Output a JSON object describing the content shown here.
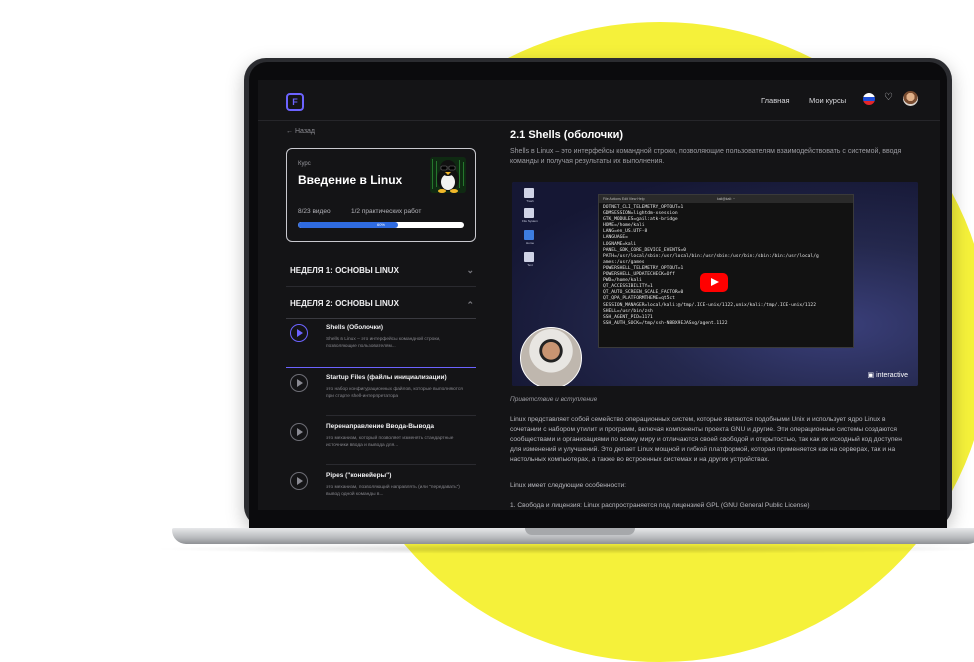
{
  "header": {
    "nav_home": "Главная",
    "nav_my_courses": "Мои курсы",
    "logo_icon": "logo-icon",
    "bell_icon": "bell-icon"
  },
  "sidebar": {
    "back_label": "← Назад",
    "course": {
      "kicker": "Курс",
      "title": "Введение в Linux",
      "videos": "8/23 видео",
      "practicals": "1/2 практических работ",
      "progress_label": "60%",
      "progress": 0.6
    },
    "weeks": [
      {
        "label": "НЕДЕЛЯ 1: ОСНОВЫ LINUX",
        "expanded": false
      },
      {
        "label": "НЕДЕЛЯ 2: ОСНОВЫ LINUX",
        "expanded": true
      }
    ],
    "lessons": [
      {
        "title": "Shells (Оболочки)",
        "desc": "Shells в Linux – это интерфейсы командной строки, позволяющие пользователям..."
      },
      {
        "title": "Startup Files (файлы инициализации)",
        "desc": "это набор конфигурационных файлов, которые выполняются при старте shell-интерпретатора"
      },
      {
        "title": "Перенаправление Ввода-Вывода",
        "desc": "это механизм, который позволяет изменять стандартные источники ввода и вывода для..."
      },
      {
        "title": "Pipes (\"конвейеры\")",
        "desc": "это механизм, позволяющий направлять (или \"передавать\") вывод одной команды в..."
      }
    ]
  },
  "main": {
    "title": "2.1 Shells (оболочки)",
    "subtitle": "Shells в Linux – это интерфейсы командной строки, позволяющие пользователям взаимодействовать с системой, вводя команды и получая результаты их выполнения.",
    "video": {
      "desktop_icons": [
        "Trash",
        "File System",
        "Home",
        "Text"
      ],
      "terminal_menu": "File  Actions  Edit  View  Help",
      "terminal_title": "kali@kali: ~",
      "terminal_lines": "DOTNET_CLI_TELEMETRY_OPTOUT=1\nGDMSESSION=lightdm-xsession\nGTK_MODULES=gail:atk-bridge\nHOME=/home/kali\nLANG=en_US.UTF-8\nLANGUAGE=\nLOGNAME=kali\nPANEL_GDK_CORE_DEVICE_EVENTS=0\nPATH=/usr/local/sbin:/usr/local/bin:/usr/sbin:/usr/bin:/sbin:/bin:/usr/local/g\names:/usr/games\nPOWERSHELL_TELEMETRY_OPTOUT=1\nPOWERSHELL_UPDATECHECK=Off\nPWD=/home/kali\nQT_ACCESSIBILITY=1\nQT_AUTO_SCREEN_SCALE_FACTOR=0\nQT_QPA_PLATFORMTHEME=qt5ct\nSESSION_MANAGER=local/kali:@/tmp/.ICE-unix/1122,unix/kali:/tmp/.ICE-unix/1122\nSHELL=/usr/bin/zsh\nSSH_AGENT_PID=1171\nSSH_AUTH_SOCK=/tmp/ssh-N8BX9EJASxg/agent.1122",
      "watermark": "interactive",
      "play_icon": "youtube-play-icon"
    },
    "caption": "Приветствие и вступление",
    "paragraph": "Linux представляет собой семейство операционных систем, которые являются подобными Unix и использует ядро Linux в сочетании с набором утилит и программ, включая компоненты проекта GNU и другие. Эти операционные системы создаются сообществами и организациями по всему миру и отличаются своей свободой и открытостью, так как их исходный код доступен для изменений и улучшений. Это делает Linux мощной и гибкой платформой, которая применяется как на серверах, так и на настольных компьютерах, а также во встроенных системах и на других устройствах.",
    "features_intro": "Linux имеет следующие особенности:",
    "feature_1": "1.  Свобода и лицензия: Linux распространяется под лицензией GPL (GNU General Public License)"
  }
}
